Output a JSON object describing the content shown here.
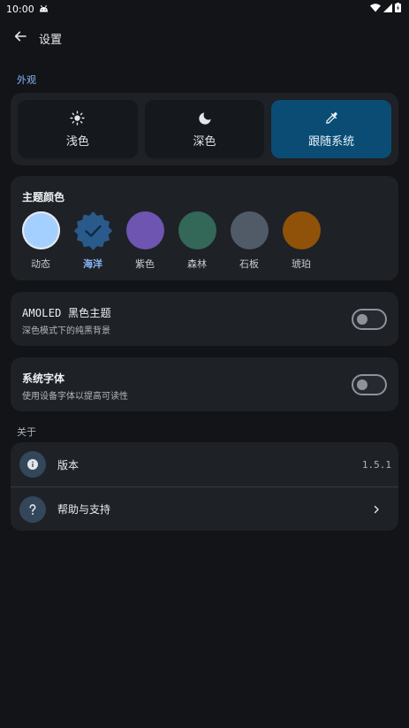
{
  "status_bar": {
    "time": "10:00",
    "icons": [
      "android-icon",
      "wifi-icon",
      "signal-icon",
      "battery-icon"
    ]
  },
  "app_bar": {
    "title": "设置",
    "back_icon": "arrow-left-icon"
  },
  "appearance": {
    "section_label": "外观",
    "modes": [
      {
        "label": "浅色",
        "icon": "sun-icon",
        "active": false
      },
      {
        "label": "深色",
        "icon": "moon-icon",
        "active": false
      },
      {
        "label": "跟随系统",
        "icon": "eyedropper-icon",
        "active": true
      }
    ]
  },
  "theme_colors": {
    "title": "主题颜色",
    "selected": "海洋",
    "items": [
      {
        "name": "动态",
        "color": "#a4d0ff"
      },
      {
        "name": "海洋",
        "color": "#2a5a8c"
      },
      {
        "name": "紫色",
        "color": "#6e55b1"
      },
      {
        "name": "森林",
        "color": "#336757"
      },
      {
        "name": "石板",
        "color": "#515b68"
      },
      {
        "name": "琥珀",
        "color": "#8f5208"
      }
    ]
  },
  "amoled": {
    "title": "AMOLED 黑色主题",
    "description": "深色模式下的纯黑背景",
    "enabled": false
  },
  "system_font": {
    "title": "系统字体",
    "description": "使用设备字体以提高可读性",
    "enabled": false
  },
  "about": {
    "section_label": "关于",
    "version_label": "版本",
    "version_value": "1.5.1",
    "help_label": "帮助与支持"
  },
  "colors": {
    "accent": "#8ab4f8",
    "active_mode_bg": "#0a4c73",
    "background": "#121417",
    "card": "#1e2126"
  }
}
